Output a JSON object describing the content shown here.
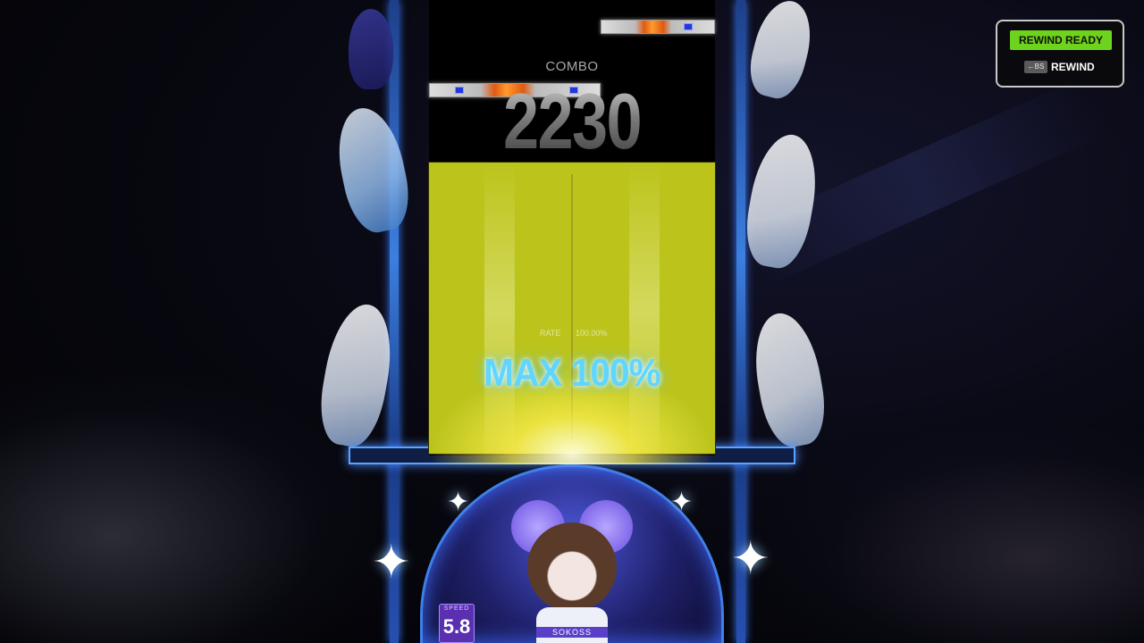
{
  "hud": {
    "combo_label": "COMBO",
    "combo_value": "2230",
    "accuracy_small_label": "RATE",
    "accuracy_small_value": "100.00%",
    "judgement_text": "MAX 100%",
    "speed_label": "SPEED",
    "speed_value": "5.8",
    "character_name": "SOKOSS"
  },
  "rewind": {
    "status": "REWIND READY",
    "key": "←BS",
    "action_label": "REWIND"
  },
  "colors": {
    "lane_highlight": "#bcc41c",
    "ready_green": "#6ed31c",
    "frame_blue": "#3b7fe0",
    "judgement_cyan": "#5fd6ff"
  },
  "icons": {
    "sparkle": "✦"
  }
}
